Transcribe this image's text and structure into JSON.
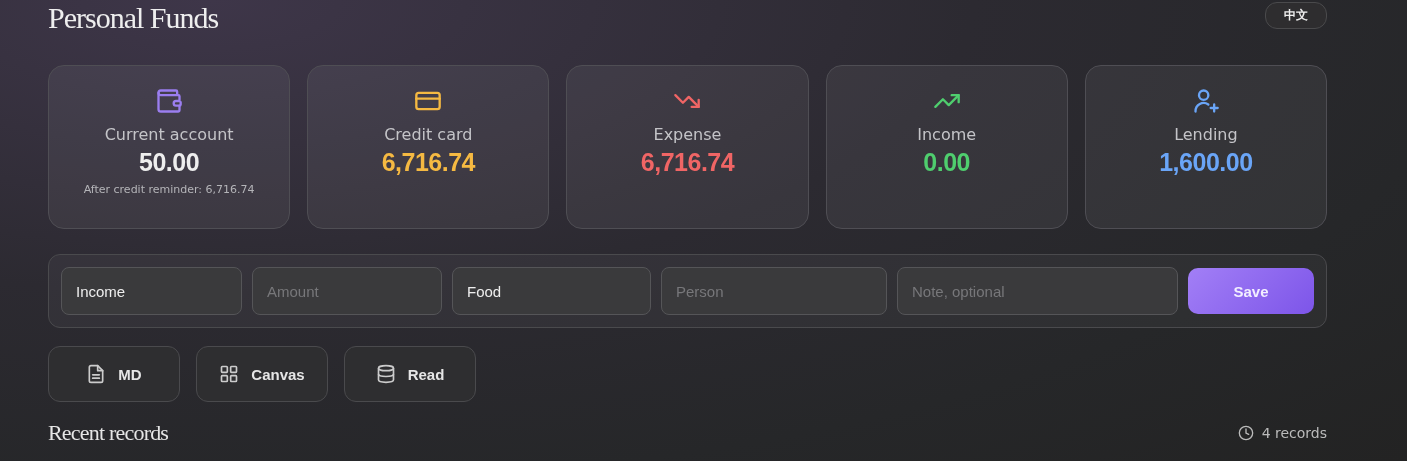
{
  "title": "Personal Funds",
  "language_button": "中文",
  "cards": [
    {
      "kind": "wallet",
      "label": "Current account",
      "value": "50.00",
      "color": "#eeeeee",
      "note": "After credit reminder: 6,716.74"
    },
    {
      "kind": "card",
      "label": "Credit card",
      "value": "6,716.74",
      "color": "#f5b942"
    },
    {
      "kind": "down",
      "label": "Expense",
      "value": "6,716.74",
      "color": "#f06565"
    },
    {
      "kind": "up",
      "label": "Income",
      "value": "0.00",
      "color": "#4fce6e"
    },
    {
      "kind": "person",
      "label": "Lending",
      "value": "1,600.00",
      "color": "#6aa5f7"
    }
  ],
  "form": {
    "fields": [
      {
        "kind": "select",
        "value": "Income"
      },
      {
        "kind": "input",
        "placeholder": "Amount"
      },
      {
        "kind": "select",
        "value": "Food"
      },
      {
        "kind": "input",
        "placeholder": "Person"
      },
      {
        "kind": "input",
        "placeholder": "Note, optional"
      }
    ],
    "save_button": "Save"
  },
  "actions": [
    {
      "kind": "doc",
      "label": "MD"
    },
    {
      "kind": "grid",
      "label": "Canvas"
    },
    {
      "kind": "db",
      "label": "Read"
    }
  ],
  "recent": {
    "title": "Recent records",
    "count": "4 records"
  }
}
